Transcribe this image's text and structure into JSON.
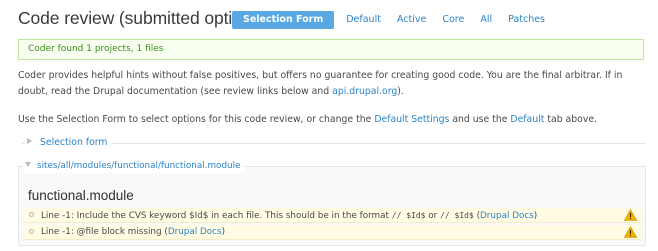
{
  "header": {
    "title": "Code review (submitted options)",
    "tabs": [
      {
        "label": "Selection Form",
        "active": true
      },
      {
        "label": "Default",
        "active": false
      },
      {
        "label": "Active",
        "active": false
      },
      {
        "label": "Core",
        "active": false
      },
      {
        "label": "All",
        "active": false
      },
      {
        "label": "Patches",
        "active": false
      }
    ]
  },
  "status": {
    "message": "Coder found 1 projects, 1 files"
  },
  "intro": {
    "text_before": "Coder provides helpful hints without false positives, but offers no guarantee for creating good code. You are the final arbitrar. If in doubt, read the Drupal documentation (see review links below and ",
    "link": "api.drupal.org",
    "text_after": ")."
  },
  "instructions": {
    "text1": "Use the Selection Form to select options for this code review, or change the ",
    "link1": "Default Settings",
    "text2": " and use the ",
    "link2": "Default",
    "text3": " tab above."
  },
  "selection_form": {
    "legend": "Selection form",
    "collapsed": true
  },
  "file_section": {
    "legend": "sites/all/modules/functional/functional.module",
    "module_title": "functional.module",
    "results": [
      {
        "text": "Line -1: Include the CVS keyword $Id$ in each file. This should be in the format ",
        "code1": "// $Id$",
        "or": " or ",
        "code2": "// $Id$",
        "link_open": " (",
        "link": "Drupal Docs",
        "link_close": ")",
        "severity_icon": "warning-icon"
      },
      {
        "text": "Line -1: @file block missing ",
        "link_open": "(",
        "link": "Drupal Docs",
        "link_close": ")",
        "severity_icon": "warning-icon"
      }
    ]
  },
  "colors": {
    "accent": "#5aa8e3",
    "link": "#2b84c6",
    "status_bg": "#f8fff0",
    "status_text": "#3d8d1f",
    "warning_bg": "#fffce3",
    "warning_icon": "#f0b400"
  }
}
